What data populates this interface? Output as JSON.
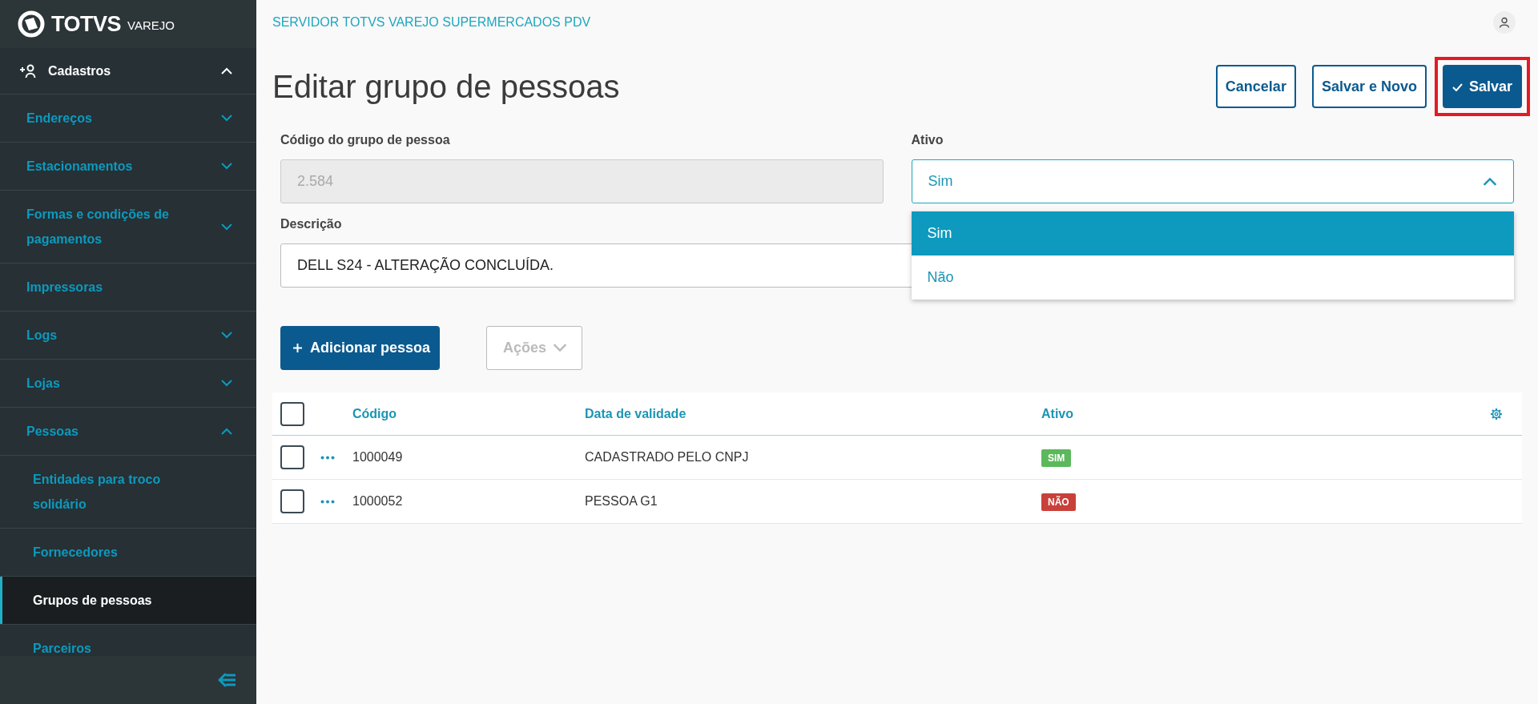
{
  "app": {
    "logo_text": "TOTVS",
    "logo_subtext": "VAREJO"
  },
  "sidebar": {
    "menu": [
      {
        "label": "Cadastros",
        "kind": "section",
        "expanded": true,
        "children": [
          {
            "label": "Endereços",
            "kind": "group",
            "expanded": false
          },
          {
            "label": "Estacionamentos",
            "kind": "group",
            "expanded": false
          },
          {
            "label": "Formas e condições de pagamentos",
            "kind": "group",
            "expanded": false
          },
          {
            "label": "Impressoras",
            "kind": "link",
            "selected": false
          },
          {
            "label": "Logs",
            "kind": "group",
            "expanded": false
          },
          {
            "label": "Lojas",
            "kind": "group",
            "expanded": false
          },
          {
            "label": "Pessoas",
            "kind": "group",
            "expanded": true,
            "children": [
              {
                "label": "Entidades para troco solidário",
                "kind": "link",
                "selected": false
              },
              {
                "label": "Fornecedores",
                "kind": "link",
                "selected": false
              },
              {
                "label": "Grupos de pessoas",
                "kind": "link",
                "selected": true
              },
              {
                "label": "Parceiros",
                "kind": "link",
                "selected": false
              }
            ]
          }
        ]
      }
    ]
  },
  "header": {
    "server_name": "SERVIDOR TOTVS VAREJO SUPERMERCADOS PDV"
  },
  "page": {
    "title": "Editar grupo de pessoas",
    "actions": [
      {
        "label": "Cancelar",
        "kind": "secondary",
        "highlighted": false
      },
      {
        "label": "Salvar e Novo",
        "kind": "secondary",
        "highlighted": false
      },
      {
        "label": "Salvar",
        "kind": "primary",
        "highlighted": true
      }
    ]
  },
  "form": {
    "code": {
      "label": "Código do grupo de pessoa",
      "value": "2.584",
      "disabled": true
    },
    "active": {
      "label": "Ativo",
      "value": "Sim",
      "expanded": true,
      "options": [
        {
          "label": "Sim",
          "selected": true
        },
        {
          "label": "Não",
          "selected": false
        }
      ]
    },
    "description": {
      "label": "Descrição",
      "value": "DELL S24 - ALTERAÇÃO CONCLUÍDA."
    }
  },
  "toolbar": {
    "add_button": "Adicionar pessoa",
    "actions_button": {
      "label": "Ações",
      "disabled": true
    }
  },
  "table": {
    "columns": [
      "Código",
      "Data de validade",
      "Ativo"
    ],
    "all_checked": false,
    "rows": [
      {
        "checked": false,
        "code": "1000049",
        "validity": "CADASTRADO PELO CNPJ",
        "status": {
          "label": "SIM",
          "color": "#5cb85c"
        }
      },
      {
        "checked": false,
        "code": "1000052",
        "validity": "PESSOA G1",
        "status": {
          "label": "NÃO",
          "color": "#c9403a"
        }
      }
    ]
  }
}
